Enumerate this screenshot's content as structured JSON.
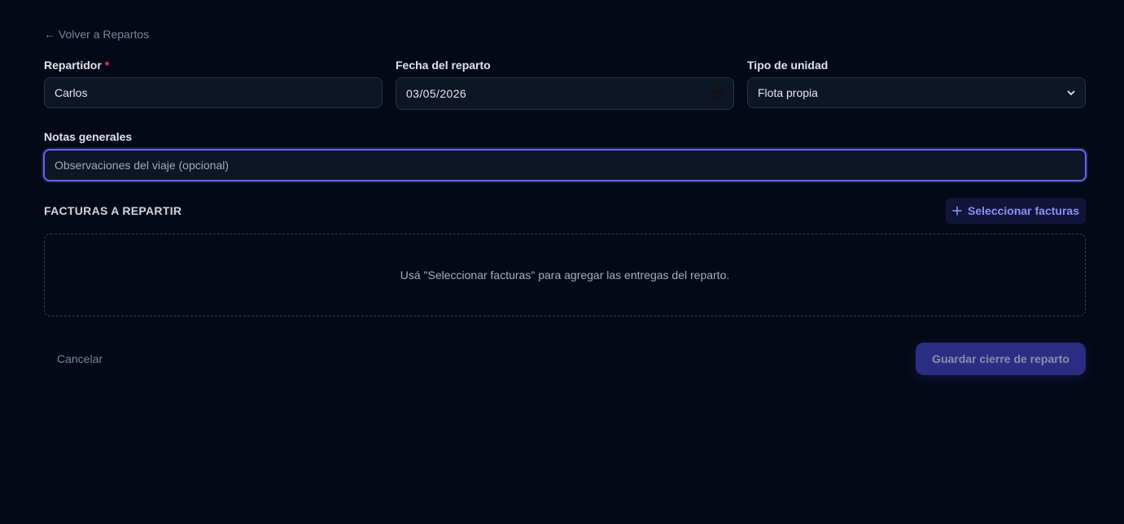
{
  "nav": {
    "back_label": "← Volver a Repartos"
  },
  "form": {
    "repartidor": {
      "label": "Repartidor",
      "required_mark": "*",
      "value": "Carlos"
    },
    "fecha": {
      "label": "Fecha del reparto",
      "value": "03/05/2026"
    },
    "tipo_unidad": {
      "label": "Tipo de unidad",
      "selected": "Flota propia"
    },
    "notas": {
      "label": "Notas generales",
      "placeholder": "Observaciones del viaje (opcional)"
    }
  },
  "facturas": {
    "title": "FACTURAS A REPARTIR",
    "select_button": "Seleccionar facturas",
    "empty_message": "Usá \"Seleccionar facturas\" para agregar las entregas del reparto."
  },
  "actions": {
    "cancel": "Cancelar",
    "save": "Guardar cierre de reparto"
  },
  "colors": {
    "background": "#050816",
    "accent": "#6366f1",
    "required": "#ef4444",
    "save_button": "#2b2d83"
  },
  "icons": {
    "calendar": "calendar-icon",
    "chevron": "chevron-down-icon",
    "plus": "plus-icon"
  }
}
